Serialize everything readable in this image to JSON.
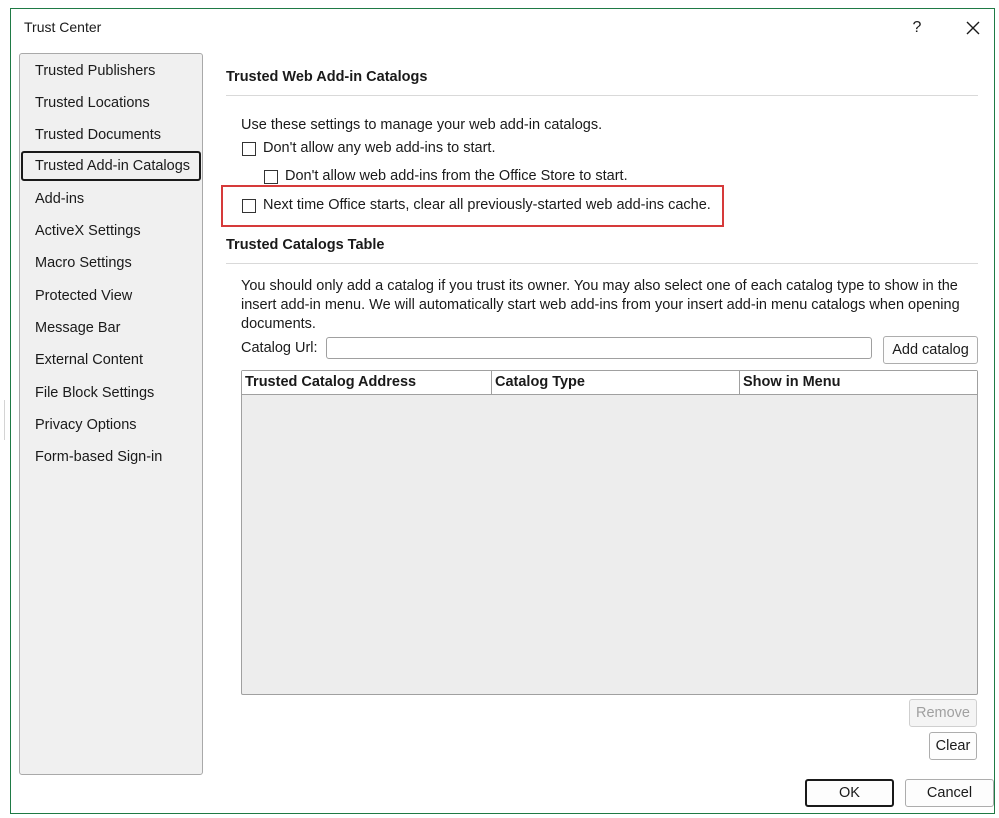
{
  "dialog": {
    "title": "Trust Center",
    "help_label": "?",
    "close_label": "✕"
  },
  "sidebar": {
    "items": [
      {
        "label": "Trusted Publishers"
      },
      {
        "label": "Trusted Locations"
      },
      {
        "label": "Trusted Documents"
      },
      {
        "label": "Trusted Add-in Catalogs",
        "selected": true
      },
      {
        "label": "Add-ins"
      },
      {
        "label": "ActiveX Settings"
      },
      {
        "label": "Macro Settings"
      },
      {
        "label": "Protected View"
      },
      {
        "label": "Message Bar"
      },
      {
        "label": "External Content"
      },
      {
        "label": "File Block Settings"
      },
      {
        "label": "Privacy Options"
      },
      {
        "label": "Form-based Sign-in"
      }
    ]
  },
  "web_catalogs": {
    "heading": "Trusted Web Add-in Catalogs",
    "intro": "Use these settings to manage your web add-in catalogs.",
    "options": [
      {
        "label": "Don't allow any web add-ins to start.",
        "checked": false
      },
      {
        "label": "Don't allow web add-ins from the Office Store to start.",
        "checked": false
      },
      {
        "label": "Next time Office starts, clear all previously-started web add-ins cache.",
        "checked": false
      }
    ]
  },
  "catalogs_table": {
    "heading": "Trusted Catalogs Table",
    "description": "You should only add a catalog if you trust its owner. You may also select one of each catalog type to show in the insert add-in menu. We will automatically start web add-ins from your insert add-in menu catalogs when opening documents.",
    "url_label": "Catalog Url:",
    "url_value": "",
    "add_button": "Add catalog",
    "columns": [
      "Trusted Catalog Address",
      "Catalog Type",
      "Show in Menu"
    ],
    "rows": [],
    "remove_button": "Remove",
    "clear_button": "Clear"
  },
  "footer": {
    "ok_label": "OK",
    "cancel_label": "Cancel"
  },
  "colors": {
    "dialog_border": "#1f7a45",
    "highlight": "#d63a3a"
  }
}
